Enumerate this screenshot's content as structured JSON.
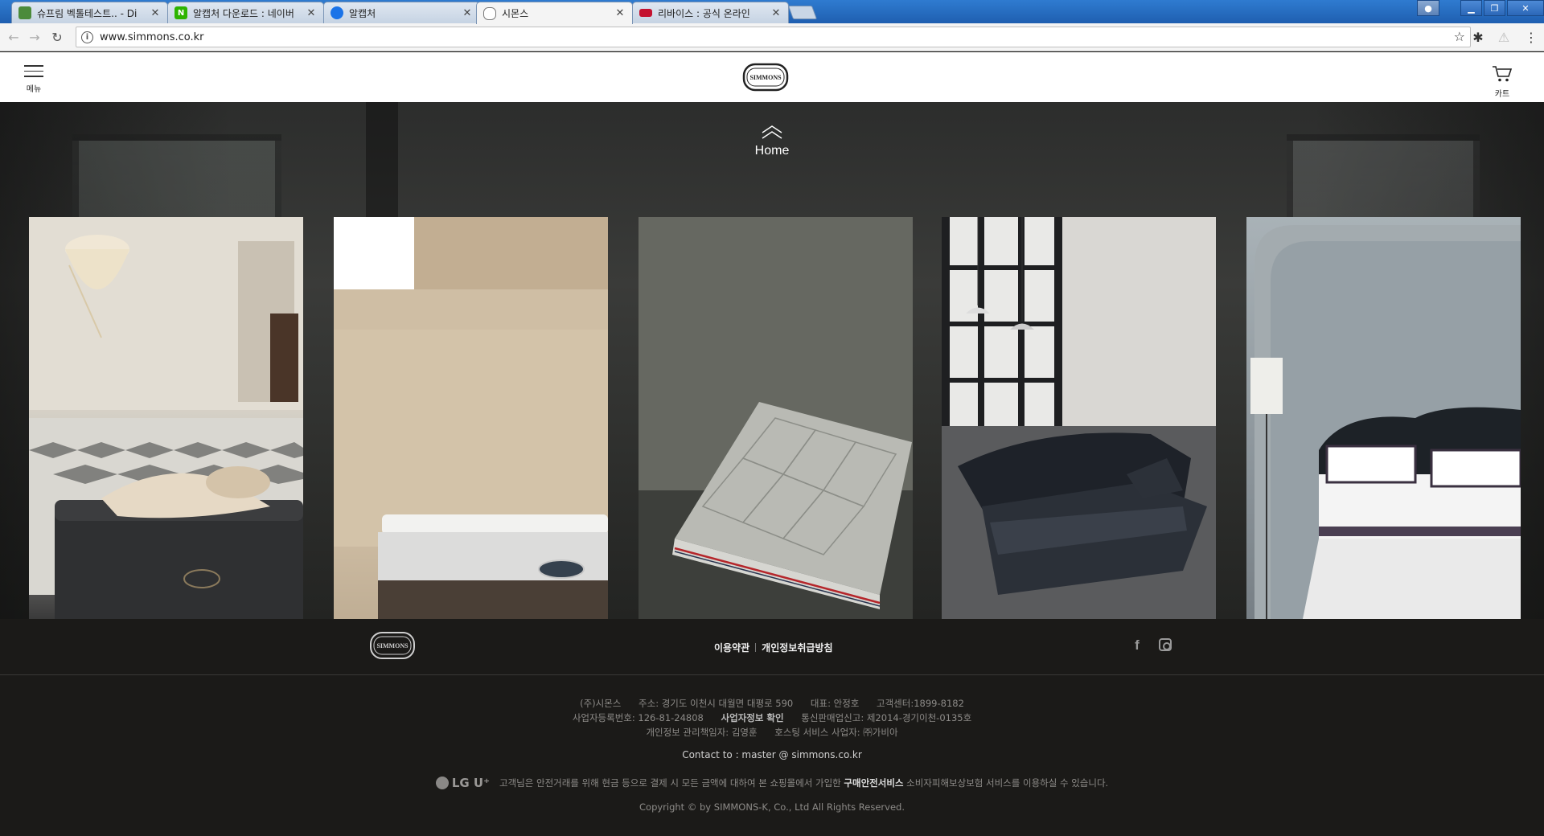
{
  "browser": {
    "tabs": [
      {
        "title": "슈프림 벡톨테스트.. - Di",
        "favicon_color": "#4b8b3b",
        "favicon_glyph": "",
        "active": false
      },
      {
        "title": "알캡처 다운로드 : 네이버",
        "favicon_color": "#2db400",
        "favicon_glyph": "N",
        "active": false
      },
      {
        "title": "알캡처",
        "favicon_color": "#1a73e8",
        "favicon_glyph": "",
        "active": false
      },
      {
        "title": "시몬스",
        "favicon_color": "#777777",
        "favicon_glyph": "",
        "active": true
      },
      {
        "title": "리바이스 : 공식 온라인",
        "favicon_color": "#c41230",
        "favicon_glyph": "",
        "active": false
      }
    ],
    "url": "www.simmons.co.kr",
    "colors": {
      "tabstrip": "#2f7bd0",
      "toolbar": "#f4f4f4"
    }
  },
  "header": {
    "menu_label": "메뉴",
    "cart_label": "카트",
    "logo_text": "SIMMONS"
  },
  "hero": {
    "home_label": "Home",
    "panels": [
      {
        "name": "beautyrest-black-mattress"
      },
      {
        "name": "beautyrest-mattress"
      },
      {
        "name": "quilted-mattress"
      },
      {
        "name": "leather-sofa"
      },
      {
        "name": "bedroom-set"
      }
    ]
  },
  "footer": {
    "logo_text": "SIMMONS",
    "links": [
      "이용약관",
      "개인정보취급방침"
    ],
    "social": [
      "facebook-icon",
      "instagram-icon"
    ],
    "info_rows": [
      [
        "(주)시몬스",
        "주소: 경기도 이천시 대월면 대평로 590",
        "대표: 안정호",
        "고객센터:1899-8182"
      ],
      [
        "사업자등록번호: 126-81-24808",
        "사업자정보 확인",
        "통신판매업신고: 제2014-경기이천-0135호"
      ],
      [
        "개인정보 관리책임자: 김영훈",
        "호스팅 서비스 사업자: ㈜가비아"
      ]
    ],
    "contact": "Contact to : master @ simmons.co.kr",
    "lgu_brand": "LG U⁺",
    "lgu_text_pre": "고객님은 안전거래를 위해 현금 등으로 결제 시 모든 금액에 대하여 본 쇼핑몰에서 가입한 ",
    "lgu_text_bold": "구매안전서비스",
    "lgu_text_post": " 소비자피해보상보험 서비스를 이용하실 수 있습니다.",
    "copyright": "Copyright © by SIMMONS-K, Co., Ltd All Rights Reserved."
  }
}
